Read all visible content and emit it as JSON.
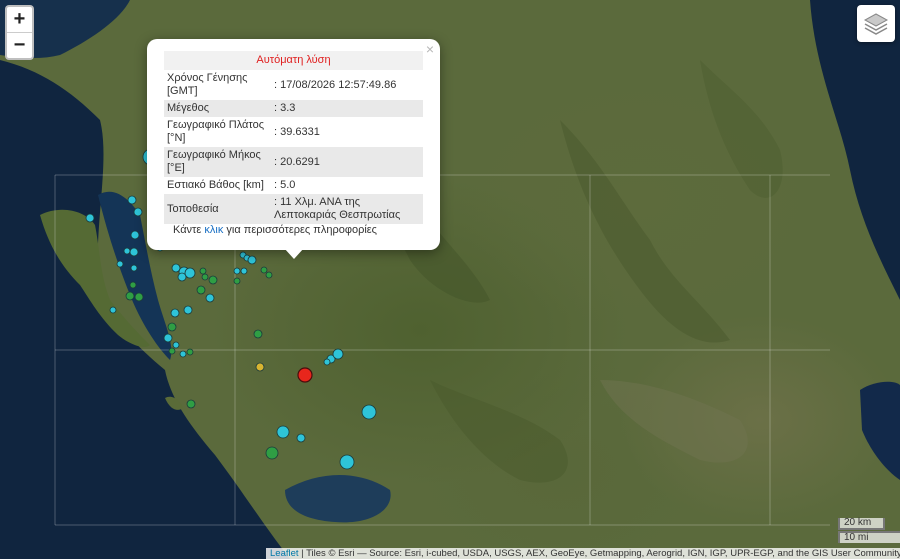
{
  "map": {
    "zoom_in_label": "+",
    "zoom_out_label": "−",
    "layers_icon": "layers-icon"
  },
  "popup": {
    "close_label": "×",
    "header": "Αυτόματη λύση",
    "rows": [
      {
        "label": "Χρόνος Γένησης [GMT]",
        "value": ": 17/08/2026 12:57:49.86"
      },
      {
        "label": "Μέγεθος",
        "value": ": 3.3"
      },
      {
        "label": "Γεωγραφικό Πλάτος [°N]",
        "value": ": 39.6331"
      },
      {
        "label": "Γεωγραφικό Μήκος [°E]",
        "value": ": 20.6291"
      },
      {
        "label": "Εστιακό Βάθος [km]",
        "value": ": 5.0"
      },
      {
        "label": "Τοποθεσία",
        "value": ": 11 Χλμ. ΑΝΑ της Λεπτοκαριάς Θεσπρωτίας"
      }
    ],
    "more_prefix": "Κάντε ",
    "more_link": "κλικ",
    "more_suffix": " για περισσότερες πληροφορίες"
  },
  "scale": {
    "km": "20 km",
    "mi": "10 mi"
  },
  "attribution": {
    "leaflet": "Leaflet",
    "text": " | Tiles © Esri — Source: Esri, i-cubed, USDA, USGS, AEX, GeoEye, Getmapping, Aerogrid, IGN, IGP, UPR-EGP, and the GIS User Community"
  },
  "colors": {
    "selected_event": "#e8261c",
    "recent_event": "#2ec4d8",
    "older_event": "#2f9e44",
    "medium_event": "#d8b431",
    "sea": "#10253f",
    "land": "#5b6a3c"
  }
}
